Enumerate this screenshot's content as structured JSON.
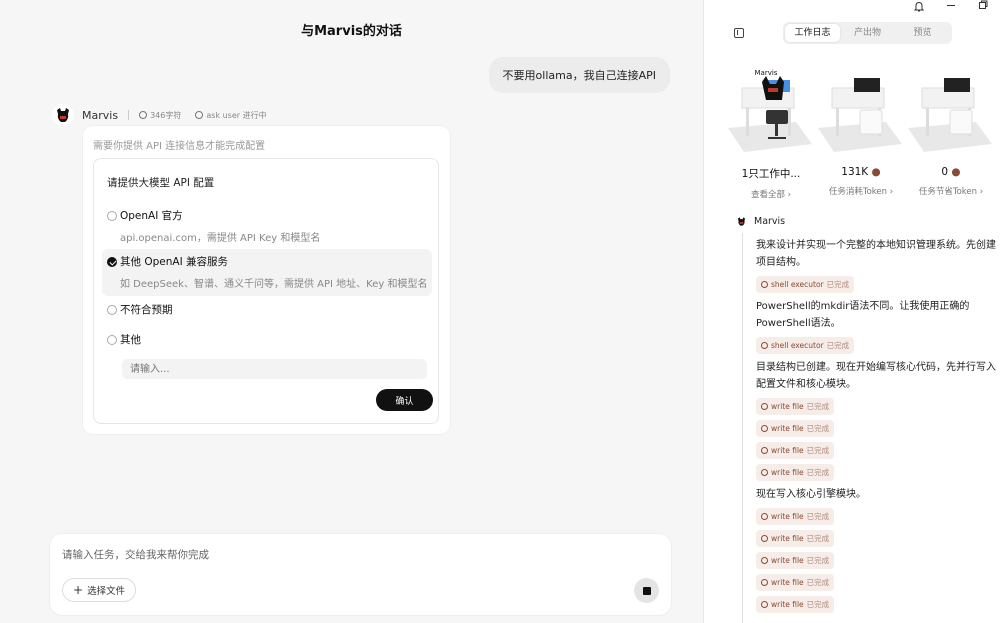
{
  "left": {
    "title": "与Marvis的对话",
    "user_message": "不要用ollama，我自己连接API",
    "agent": {
      "name": "Marvis",
      "char_count": "346字符",
      "status": "ask user 进行中"
    },
    "card": {
      "hint": "需要你提供 API 连接信息才能完成配置",
      "question": "请提供大模型 API 配置",
      "options": [
        {
          "label": "OpenAI 官方",
          "desc": "api.openai.com，需提供 API Key 和模型名"
        },
        {
          "label": "其他 OpenAI 兼容服务",
          "desc": "如 DeepSeek、智谱、通义千问等，需提供 API 地址、Key 和模型名"
        },
        {
          "label": "不符合预期",
          "desc": ""
        },
        {
          "label": "其他",
          "desc": ""
        }
      ],
      "other_placeholder": "请输入...",
      "confirm_label": "确认"
    },
    "composer": {
      "placeholder": "请输入任务，交给我来帮你完成",
      "file_button": "选择文件"
    }
  },
  "right": {
    "tabs": [
      "工作日志",
      "产出物",
      "预览"
    ],
    "active_tab": "工作日志",
    "desk_label": "Marvis",
    "stats": [
      {
        "value": "1只工作中...",
        "link": "查看全部"
      },
      {
        "value": "131K",
        "link": "任务消耗Token"
      },
      {
        "value": "0",
        "link": "任务节省Token"
      }
    ],
    "log_agent": "Marvis",
    "log": [
      {
        "type": "text",
        "text": "我来设计并实现一个完整的本地知识管理系统。先创建项目结构。"
      },
      {
        "type": "chip",
        "tool": "shell executor",
        "state": "已完成"
      },
      {
        "type": "text",
        "text": "PowerShell的mkdir语法不同。让我使用正确的PowerShell语法。"
      },
      {
        "type": "chip",
        "tool": "shell executor",
        "state": "已完成"
      },
      {
        "type": "text",
        "text": "目录结构已创建。现在开始编写核心代码，先并行写入配置文件和核心模块。"
      },
      {
        "type": "chip",
        "tool": "write file",
        "state": "已完成"
      },
      {
        "type": "chip",
        "tool": "write file",
        "state": "已完成"
      },
      {
        "type": "chip",
        "tool": "write file",
        "state": "已完成"
      },
      {
        "type": "chip",
        "tool": "write file",
        "state": "已完成"
      },
      {
        "type": "text",
        "text": "现在写入核心引擎模块。"
      },
      {
        "type": "chip",
        "tool": "write file",
        "state": "已完成"
      },
      {
        "type": "chip",
        "tool": "write file",
        "state": "已完成"
      },
      {
        "type": "chip",
        "tool": "write file",
        "state": "已完成"
      },
      {
        "type": "chip",
        "tool": "write file",
        "state": "已完成"
      },
      {
        "type": "chip",
        "tool": "write file",
        "state": "已完成"
      }
    ]
  }
}
